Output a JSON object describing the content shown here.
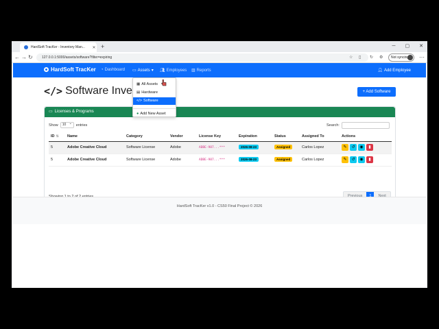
{
  "browser": {
    "tab_title": "HardSoft TracKer - Inventory Man...",
    "url": "127.0.0.1:5000/assets/software?filter=expiring",
    "profile_label": "Not syncing"
  },
  "navbar": {
    "brand": "HardSoft TracKer",
    "links": [
      "Dashboard",
      "Assets",
      "Employees",
      "Reports"
    ],
    "add_employee": "Add Employee"
  },
  "dropdown": {
    "items": [
      "All Assets",
      "Hardware",
      "Software"
    ],
    "add_new": "Add New Asset"
  },
  "page": {
    "title": "Software Inventory",
    "visible_title": "Software Inve",
    "add_button": "+ Add Software"
  },
  "card": {
    "header": "Licenses & Programs",
    "show_label": "Show",
    "show_value": "10",
    "entries_label": "entries",
    "search_label": "Search:",
    "columns": [
      "ID",
      "Name",
      "Category",
      "Vendor",
      "License Key",
      "Expiration",
      "Status",
      "Assigned To",
      "Actions"
    ],
    "rows": [
      {
        "id": "5",
        "name": "Adobe Creative Cloud",
        "category": "Software License",
        "vendor": "Adobe",
        "key": "ADBE-987...***",
        "expiration": "2026-08-23",
        "status": "Assigned",
        "assigned": "Carlos Lopez"
      },
      {
        "id": "5",
        "name": "Adobe Creative Cloud",
        "category": "Software License",
        "vendor": "Adobe",
        "key": "ADBE-987...***",
        "expiration": "2026-08-23",
        "status": "Assigned",
        "assigned": "Carlos Lopez"
      }
    ],
    "info": "Showing 1 to 2 of 2 entries",
    "pager": {
      "previous": "Previous",
      "current": "1",
      "next": "Next"
    }
  },
  "footer": "HardSoft TracKer v1.0 - CS50 Final Project © 2026",
  "colors": {
    "primary": "#0d6efd",
    "success": "#198754",
    "info": "#0dcaf0",
    "warning": "#ffc107",
    "danger": "#dc3545"
  }
}
